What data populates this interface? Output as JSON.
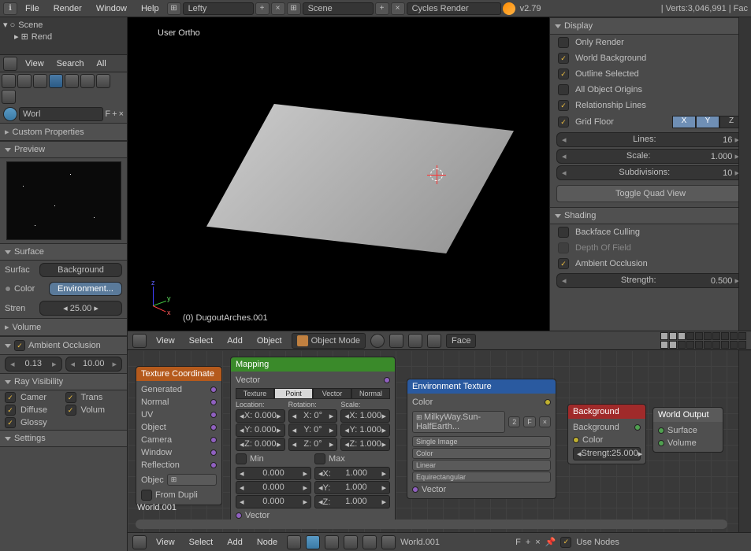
{
  "topbar": {
    "menus": [
      "File",
      "Render",
      "Window",
      "Help"
    ],
    "layout": "Lefty",
    "scene": "Scene",
    "engine": "Cycles Render",
    "version": "v2.79",
    "stats": "Verts:3,046,991 | Fac"
  },
  "outliner": {
    "scene": "Scene",
    "child": "Rend"
  },
  "left_viewbar": {
    "view": "View",
    "search": "Search",
    "all": "All"
  },
  "world_selector": {
    "label": "Worl",
    "new": "F"
  },
  "left_panel": {
    "custom_props": "Custom Properties",
    "preview": "Preview",
    "surface": "Surface",
    "surface_row": {
      "label": "Surfac",
      "type": "Background"
    },
    "color_row": {
      "label": "Color",
      "type": "Environment..."
    },
    "strength_row": {
      "label": "Stren",
      "value": "25.00"
    },
    "volume": "Volume",
    "ao_header": "Ambient Occlusion",
    "ao_factor": "0.13",
    "ao_distance": "10.00",
    "ray_vis": "Ray Visibility",
    "ray_items": {
      "camera": "Camer",
      "trans": "Trans",
      "diffuse": "Diffuse",
      "volume": "Volum",
      "glossy": "Glossy"
    },
    "settings": "Settings"
  },
  "viewport": {
    "label": "User Ortho",
    "selected": "(0) DugoutArches.001"
  },
  "n_panel": {
    "display": "Display",
    "only_render": "Only Render",
    "world_bg": "World Background",
    "outline_sel": "Outline Selected",
    "obj_origins": "All Object Origins",
    "rel_lines": "Relationship Lines",
    "grid_floor": "Grid Floor",
    "lines_label": "Lines:",
    "lines_val": "16",
    "scale_label": "Scale:",
    "scale_val": "1.000",
    "subdiv_label": "Subdivisions:",
    "subdiv_val": "10",
    "toggle_quad": "Toggle Quad View",
    "shading": "Shading",
    "backface": "Backface Culling",
    "dof": "Depth Of Field",
    "ao": "Ambient Occlusion",
    "strength_label": "Strength:",
    "strength_val": "0.500"
  },
  "view_toolbar": {
    "view": "View",
    "select": "Select",
    "add": "Add",
    "object": "Object",
    "mode": "Object Mode",
    "orientation": "Face"
  },
  "nodes": {
    "tex_coord": {
      "title": "Texture Coordinate",
      "outputs": [
        "Generated",
        "Normal",
        "UV",
        "Object",
        "Camera",
        "Window",
        "Reflection"
      ],
      "object_label": "Objec",
      "from_dupli": "From Dupli",
      "label": "World.001"
    },
    "mapping": {
      "title": "Mapping",
      "vector_out": "Vector",
      "tabs": [
        "Texture",
        "Point",
        "Vector",
        "Normal"
      ],
      "cols": [
        "Location:",
        "Rotation:",
        "Scale:"
      ],
      "rows": [
        {
          "loc": "X: 0.000",
          "rot": "X: 0°",
          "scl": "X: 1.000"
        },
        {
          "loc": "Y: 0.000",
          "rot": "Y: 0°",
          "scl": "Y: 1.000"
        },
        {
          "loc": "Z: 0.000",
          "rot": "Z: 0°",
          "scl": "Z: 1.000"
        }
      ],
      "min": "Min",
      "max": "Max",
      "minvals": [
        "0.000",
        "0.000",
        "0.000"
      ],
      "maxvals": [
        "1.000",
        "1.000",
        "1.000"
      ],
      "vector_in": "Vector"
    },
    "envtex": {
      "title": "Environment Texture",
      "color_out": "Color",
      "image": "MilkyWay.Sun-HalfEarth...",
      "users": "2",
      "fake": "F",
      "opts": [
        "Single Image",
        "Color",
        "Linear",
        "Equirectangular"
      ],
      "vector_in": "Vector"
    },
    "background": {
      "title": "Background",
      "bg_out": "Background",
      "color_in": "Color",
      "strength": "Strengt:25.000"
    },
    "world_output": {
      "title": "World Output",
      "surface": "Surface",
      "volume": "Volume"
    }
  },
  "node_bar": {
    "view": "View",
    "select": "Select",
    "add": "Add",
    "node": "Node",
    "world": "World.001",
    "use_nodes": "Use Nodes"
  }
}
